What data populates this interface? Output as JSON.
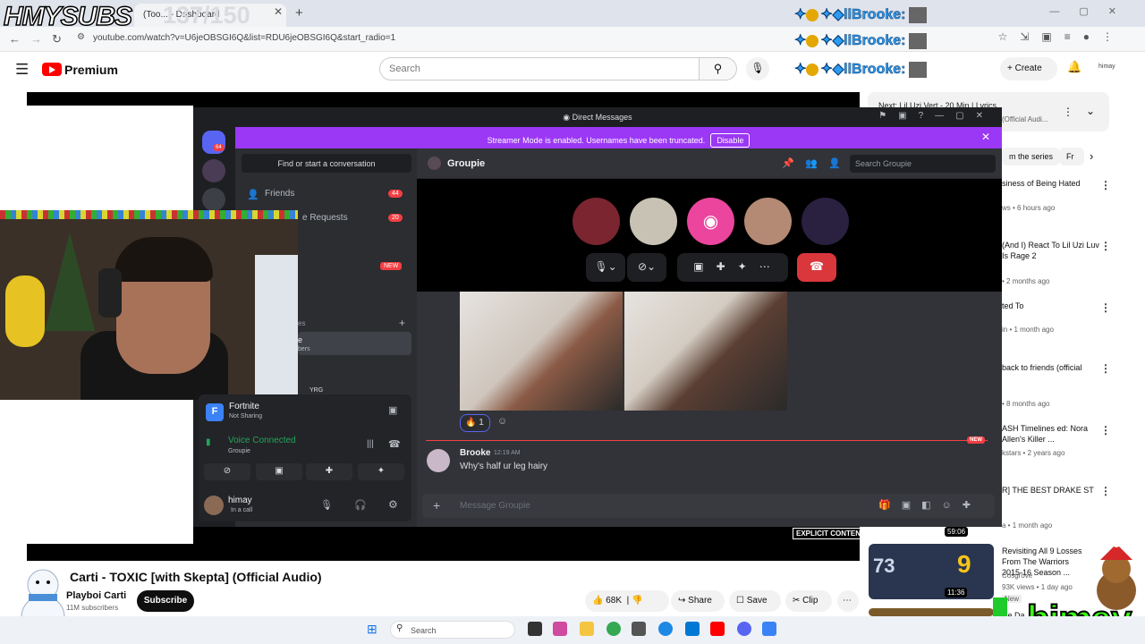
{
  "browser": {
    "tab_title": "(Too... - Dashboard",
    "url": "youtube.com/watch?v=U6jeOBSGI6Q&list=RDU6jeOBSGI6Q&start_radio=1"
  },
  "overlay": {
    "channel_tag": "HMYSUBS",
    "sub_counter": "137/150",
    "donor_name": "llBrooke:",
    "streamer_name": "himay"
  },
  "youtube": {
    "brand": "Premium",
    "search_placeholder": "Search",
    "create_label": "Create",
    "account_label": "himay",
    "video_title": "Carti - TOXIC [with Skepta] (Official Audio)",
    "channel_name": "Playboi Carti",
    "subscribers": "11M subscribers",
    "subscribe_label": "Subscribe",
    "likes": "68K",
    "share_label": "Share",
    "save_label": "Save",
    "clip_label": "Clip",
    "explicit_label": "EXPLICIT CONTENT",
    "up_next_label": "Next: Lil Uzi Vert - 20 Min | Lyrics",
    "up_next_sub": "(Official Audi...",
    "chips": [
      "m the series",
      "Fr"
    ],
    "sidebar": [
      {
        "title": "siness of Being Hated",
        "meta": "ws • 6 hours ago"
      },
      {
        "title": "(And I) React To Lil Uzi Luv Is Rage 2",
        "meta": "• 2 months ago"
      },
      {
        "title": "ted To",
        "meta": "in • 1 month ago"
      },
      {
        "title": "back to friends (official",
        "meta": "• 8 months ago"
      },
      {
        "title": "ASH Timelines ed: Nora Allen's Killer ...",
        "meta": "kstars • 2 years ago"
      },
      {
        "title": "R] THE BEST DRAKE ST",
        "meta": "a • 1 month ago",
        "duration": "59:06"
      },
      {
        "title": "Revisiting All 9 Losses From The Warriors 2015-16 Season ...",
        "channel": "Cosgrove",
        "meta": "93K views • 1 day ago",
        "duration": "11:36",
        "badge": "New"
      },
      {
        "title": "He Da",
        "meta": ""
      }
    ]
  },
  "discord": {
    "window_title": "Direct Messages",
    "streamer_banner": "Streamer Mode is enabled. Usernames have been truncated.",
    "disable_label": "Disable",
    "find_conversation": "Find or start a conversation",
    "friends_label": "Friends",
    "friends_count": "44",
    "requests_label": "e Requests",
    "requests_count": "20",
    "new_tag": "NEW",
    "dm_section": "es",
    "dm_group_short": "e",
    "dm_group_sub": "bers",
    "dm_yrg": "YRG",
    "guild_badge": "64",
    "activity_name": "Fortnite",
    "activity_status": "Not Sharing",
    "voice_status": "Voice Connected",
    "voice_channel": "Groupie",
    "username": "himay",
    "user_status": "In a call",
    "channel_name": "Groupie",
    "search_placeholder": "Search Groupie",
    "reaction_count": "1",
    "new_marker": "NEW",
    "message_author": "Brooke",
    "message_time": "12:19 AM",
    "message_text": "Why's half ur leg hairy",
    "message_placeholder": "Message Groupie"
  },
  "taskbar": {
    "search_label": "Search"
  },
  "colors": {
    "youtube_red": "#ff0000",
    "discord_blurple": "#5865f2",
    "streamer_purple": "#9b38f5",
    "hangup_red": "#da373c",
    "voice_green": "#23a55a"
  }
}
